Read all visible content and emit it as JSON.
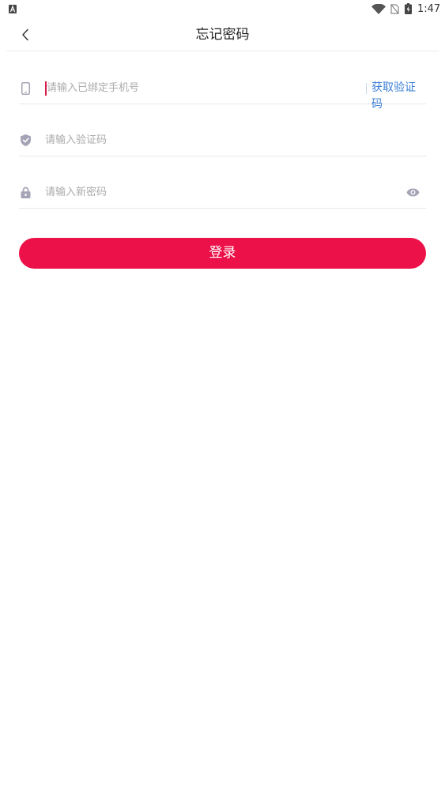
{
  "status_bar": {
    "time": "1:47",
    "icons": [
      "notification-app-icon",
      "wifi-icon",
      "no-sim-icon",
      "battery-charging-icon"
    ]
  },
  "header": {
    "back_icon": "chevron-left-icon",
    "title": "忘记密码"
  },
  "form": {
    "phone": {
      "icon": "phone-icon",
      "placeholder": "请输入已绑定手机号",
      "value": ""
    },
    "get_code_label": "获取验证码",
    "code": {
      "icon": "shield-check-icon",
      "placeholder": "请输入验证码",
      "value": ""
    },
    "new_password": {
      "icon": "lock-icon",
      "placeholder": "请输入新密码",
      "value": "",
      "toggle_icon": "eye-icon"
    }
  },
  "submit": {
    "label": "登录"
  },
  "colors": {
    "accent": "#EC1148",
    "link": "#3D7FD6",
    "icon": "#A4A4B6",
    "placeholder": "#ABABAB",
    "divider": "#E7E7E7",
    "caret": "#D81B48"
  }
}
